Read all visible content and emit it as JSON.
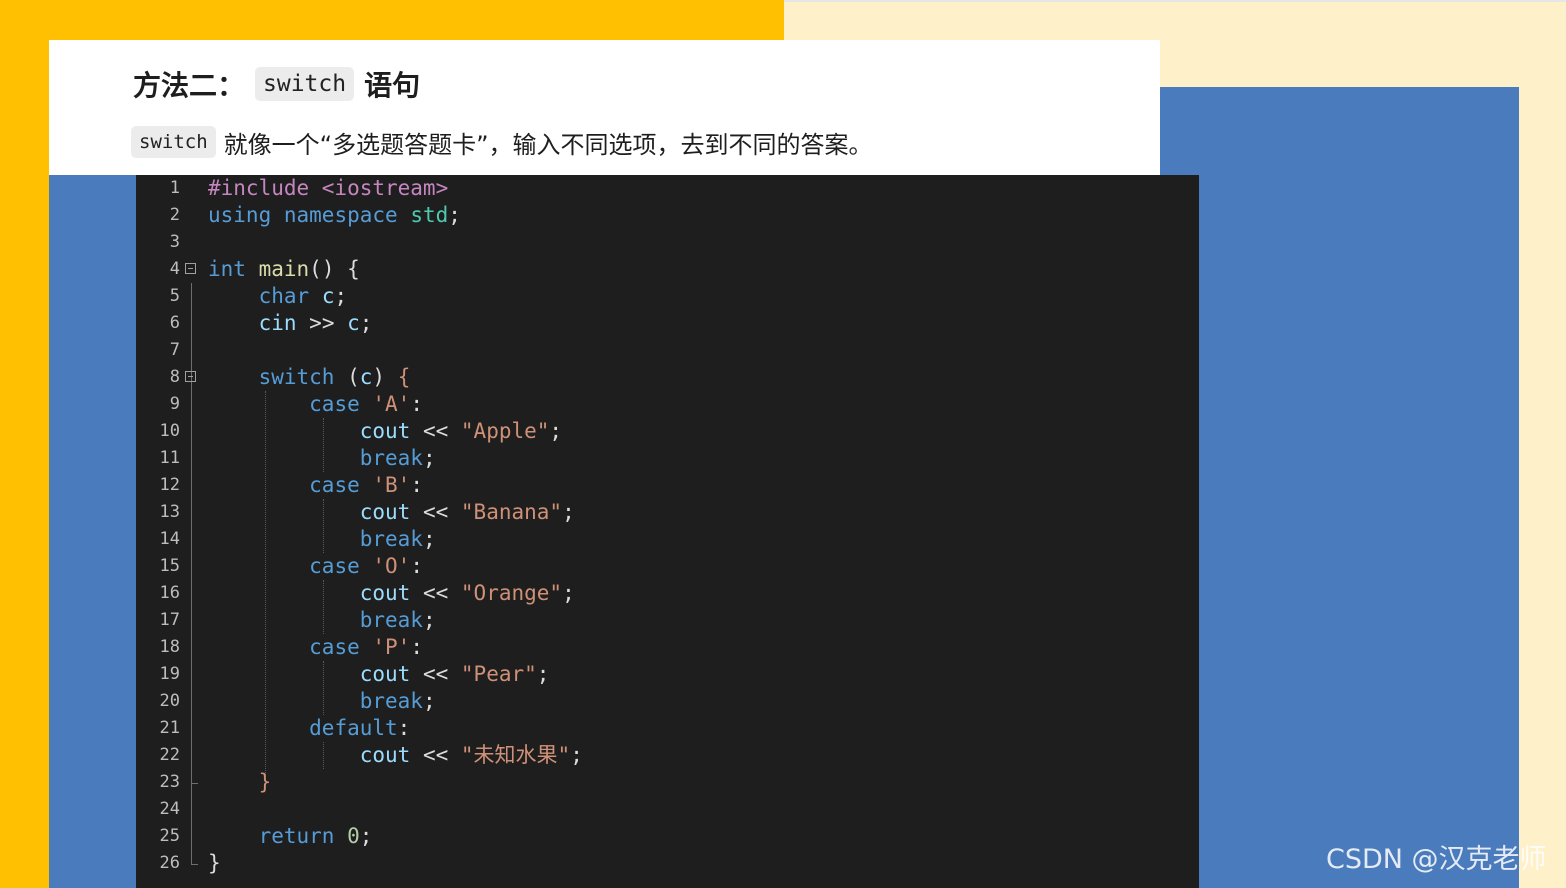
{
  "slide": {
    "title_prefix": "方法二：",
    "title_code": "switch",
    "title_suffix": "语句",
    "desc_code": "switch",
    "desc_text": "就像一个“多选题答题卡”，输入不同选项，去到不同的答案。"
  },
  "code_lines": [
    {
      "n": "1",
      "tokens": [
        [
          "pre",
          "#include <iostream>"
        ]
      ]
    },
    {
      "n": "2",
      "tokens": [
        [
          "kw",
          "using"
        ],
        [
          "sp",
          " "
        ],
        [
          "kw",
          "namespace"
        ],
        [
          "sp",
          " "
        ],
        [
          "typ",
          "std"
        ],
        [
          "pu",
          ";"
        ]
      ]
    },
    {
      "n": "3",
      "tokens": []
    },
    {
      "n": "4",
      "tokens": [
        [
          "kw",
          "int"
        ],
        [
          "sp",
          " "
        ],
        [
          "fn",
          "main"
        ],
        [
          "pu",
          "() {"
        ]
      ]
    },
    {
      "n": "5",
      "tokens": [
        [
          "sp",
          "    "
        ],
        [
          "kw",
          "char"
        ],
        [
          "sp",
          " "
        ],
        [
          "id",
          "c"
        ],
        [
          "pu",
          ";"
        ]
      ]
    },
    {
      "n": "6",
      "tokens": [
        [
          "sp",
          "    "
        ],
        [
          "id",
          "cin"
        ],
        [
          "sp",
          " "
        ],
        [
          "op",
          ">>"
        ],
        [
          "sp",
          " "
        ],
        [
          "id",
          "c"
        ],
        [
          "pu",
          ";"
        ]
      ]
    },
    {
      "n": "7",
      "tokens": []
    },
    {
      "n": "8",
      "tokens": [
        [
          "sp",
          "    "
        ],
        [
          "kw",
          "switch"
        ],
        [
          "sp",
          " "
        ],
        [
          "pu",
          "("
        ],
        [
          "id",
          "c"
        ],
        [
          "pu",
          ")"
        ],
        [
          "sp",
          " "
        ],
        [
          "br2",
          "{"
        ]
      ]
    },
    {
      "n": "9",
      "tokens": [
        [
          "sp",
          "        "
        ],
        [
          "kw",
          "case"
        ],
        [
          "sp",
          " "
        ],
        [
          "str",
          "'A'"
        ],
        [
          "pu",
          ":"
        ]
      ]
    },
    {
      "n": "10",
      "tokens": [
        [
          "sp",
          "            "
        ],
        [
          "id",
          "cout"
        ],
        [
          "sp",
          " "
        ],
        [
          "op",
          "<<"
        ],
        [
          "sp",
          " "
        ],
        [
          "str",
          "\"Apple\""
        ],
        [
          "pu",
          ";"
        ]
      ]
    },
    {
      "n": "11",
      "tokens": [
        [
          "sp",
          "            "
        ],
        [
          "kw",
          "break"
        ],
        [
          "pu",
          ";"
        ]
      ]
    },
    {
      "n": "12",
      "tokens": [
        [
          "sp",
          "        "
        ],
        [
          "kw",
          "case"
        ],
        [
          "sp",
          " "
        ],
        [
          "str",
          "'B'"
        ],
        [
          "pu",
          ":"
        ]
      ]
    },
    {
      "n": "13",
      "tokens": [
        [
          "sp",
          "            "
        ],
        [
          "id",
          "cout"
        ],
        [
          "sp",
          " "
        ],
        [
          "op",
          "<<"
        ],
        [
          "sp",
          " "
        ],
        [
          "str",
          "\"Banana\""
        ],
        [
          "pu",
          ";"
        ]
      ]
    },
    {
      "n": "14",
      "tokens": [
        [
          "sp",
          "            "
        ],
        [
          "kw",
          "break"
        ],
        [
          "pu",
          ";"
        ]
      ]
    },
    {
      "n": "15",
      "tokens": [
        [
          "sp",
          "        "
        ],
        [
          "kw",
          "case"
        ],
        [
          "sp",
          " "
        ],
        [
          "str",
          "'O'"
        ],
        [
          "pu",
          ":"
        ]
      ]
    },
    {
      "n": "16",
      "tokens": [
        [
          "sp",
          "            "
        ],
        [
          "id",
          "cout"
        ],
        [
          "sp",
          " "
        ],
        [
          "op",
          "<<"
        ],
        [
          "sp",
          " "
        ],
        [
          "str",
          "\"Orange\""
        ],
        [
          "pu",
          ";"
        ]
      ]
    },
    {
      "n": "17",
      "tokens": [
        [
          "sp",
          "            "
        ],
        [
          "kw",
          "break"
        ],
        [
          "pu",
          ";"
        ]
      ]
    },
    {
      "n": "18",
      "tokens": [
        [
          "sp",
          "        "
        ],
        [
          "kw",
          "case"
        ],
        [
          "sp",
          " "
        ],
        [
          "str",
          "'P'"
        ],
        [
          "pu",
          ":"
        ]
      ]
    },
    {
      "n": "19",
      "tokens": [
        [
          "sp",
          "            "
        ],
        [
          "id",
          "cout"
        ],
        [
          "sp",
          " "
        ],
        [
          "op",
          "<<"
        ],
        [
          "sp",
          " "
        ],
        [
          "str",
          "\"Pear\""
        ],
        [
          "pu",
          ";"
        ]
      ]
    },
    {
      "n": "20",
      "tokens": [
        [
          "sp",
          "            "
        ],
        [
          "kw",
          "break"
        ],
        [
          "pu",
          ";"
        ]
      ]
    },
    {
      "n": "21",
      "tokens": [
        [
          "sp",
          "        "
        ],
        [
          "kw",
          "default"
        ],
        [
          "pu",
          ":"
        ]
      ]
    },
    {
      "n": "22",
      "tokens": [
        [
          "sp",
          "            "
        ],
        [
          "id",
          "cout"
        ],
        [
          "sp",
          " "
        ],
        [
          "op",
          "<<"
        ],
        [
          "sp",
          " "
        ],
        [
          "str",
          "\"未知水果\""
        ],
        [
          "pu",
          ";"
        ]
      ]
    },
    {
      "n": "23",
      "tokens": [
        [
          "sp",
          "    "
        ],
        [
          "br2",
          "}"
        ]
      ]
    },
    {
      "n": "24",
      "tokens": []
    },
    {
      "n": "25",
      "tokens": [
        [
          "sp",
          "    "
        ],
        [
          "kw",
          "return"
        ],
        [
          "sp",
          " "
        ],
        [
          "num",
          "0"
        ],
        [
          "pu",
          ";"
        ]
      ]
    },
    {
      "n": "26",
      "tokens": [
        [
          "br",
          "}"
        ]
      ]
    }
  ],
  "watermark": "CSDN @汉克老师",
  "colors": {
    "yellow": "#fec000",
    "cream": "#fef0c8",
    "blue": "#4a7bbd",
    "editor_bg": "#1e1e1e"
  }
}
